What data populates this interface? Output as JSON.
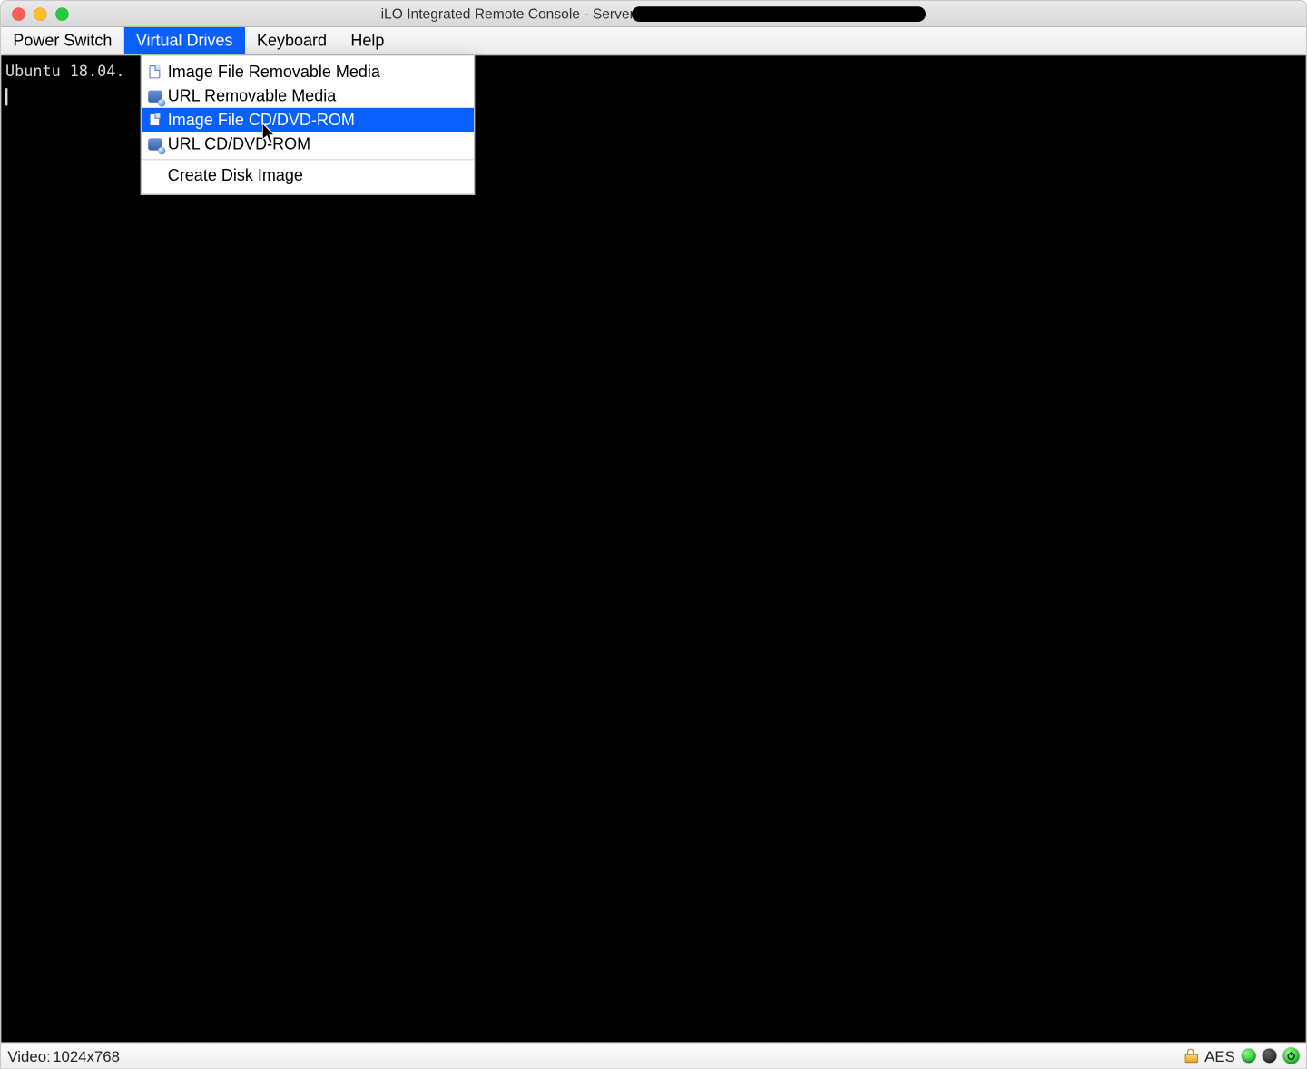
{
  "titlebar": {
    "title_prefix": "iLO Integrated Remote Console - Server"
  },
  "menubar": {
    "items": [
      {
        "label": "Power Switch",
        "active": false
      },
      {
        "label": "Virtual Drives",
        "active": true
      },
      {
        "label": "Keyboard",
        "active": false
      },
      {
        "label": "Help",
        "active": false
      }
    ]
  },
  "dropdown": {
    "items": [
      {
        "label": "Image File Removable Media",
        "icon": "doc",
        "hover": false
      },
      {
        "label": "URL Removable Media",
        "icon": "net",
        "hover": false
      },
      {
        "label": "Image File CD/DVD-ROM",
        "icon": "doc",
        "hover": true
      },
      {
        "label": "URL CD/DVD-ROM",
        "icon": "net",
        "hover": false
      }
    ],
    "after_sep": [
      {
        "label": "Create Disk Image",
        "icon": "",
        "hover": false
      }
    ]
  },
  "console": {
    "line0": "Ubuntu 18.04.",
    "prompt_line": " "
  },
  "statusbar": {
    "video_label": "Video:",
    "video_value": "1024x768",
    "encryption": "AES"
  }
}
